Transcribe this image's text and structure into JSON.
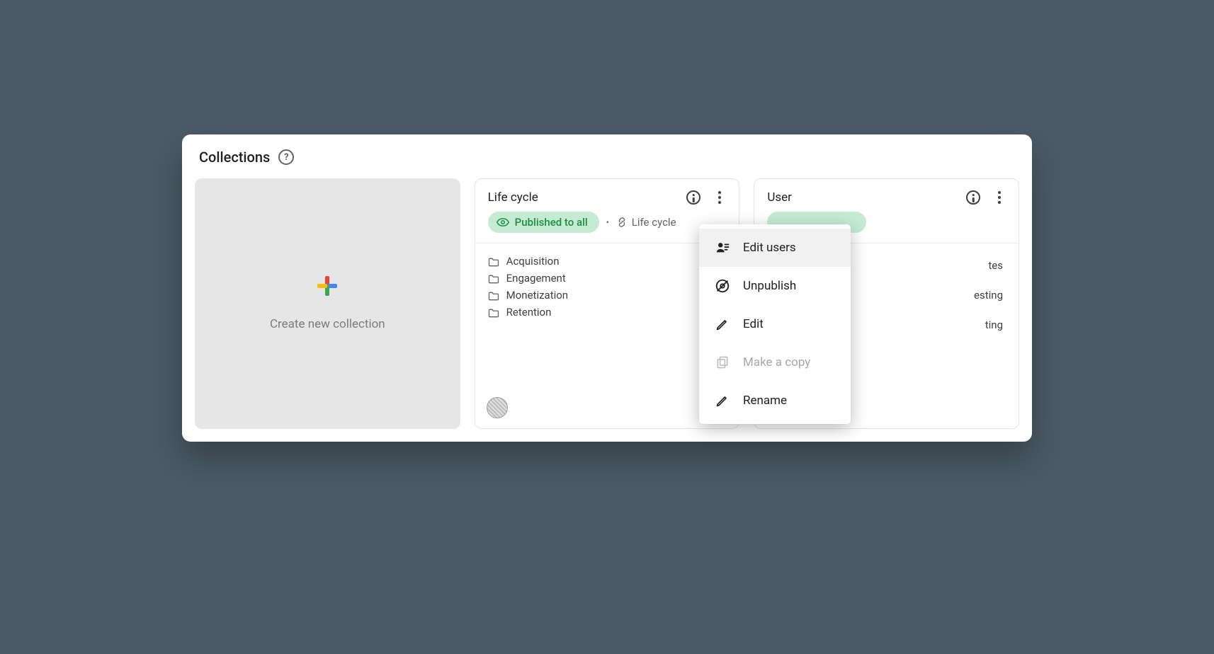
{
  "header": {
    "title": "Collections"
  },
  "create_card": {
    "label": "Create new collection"
  },
  "cards": {
    "lifecycle": {
      "title": "Life cycle",
      "status": "Published to all",
      "meta_linked": "Life cycle",
      "items": [
        "Acquisition",
        "Engagement",
        "Monetization",
        "Retention"
      ]
    },
    "user": {
      "title": "User",
      "peek_items": [
        "tes",
        "esting",
        "ting"
      ]
    }
  },
  "menu": {
    "edit_users": "Edit users",
    "unpublish": "Unpublish",
    "edit": "Edit",
    "make_copy": "Make a copy",
    "rename": "Rename"
  }
}
